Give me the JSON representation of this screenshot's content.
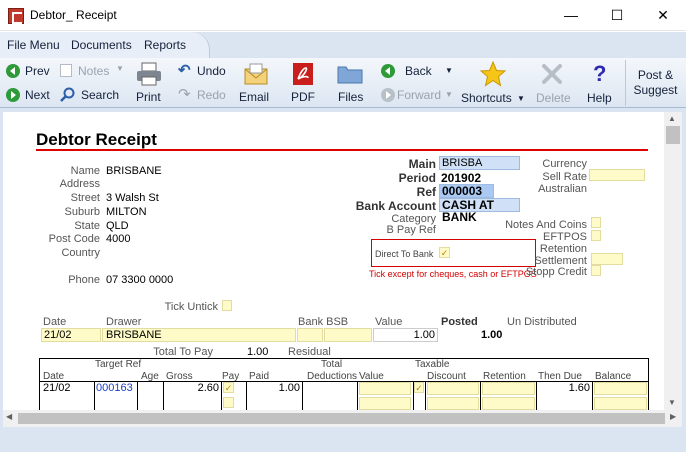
{
  "window": {
    "title": "Debtor_ Receipt",
    "minimize": "—",
    "maximize": "☐",
    "close": "✕"
  },
  "menu": {
    "items": [
      "File Menu",
      "Documents",
      "Reports"
    ]
  },
  "toolbar": {
    "prev": "Prev",
    "next": "Next",
    "notes": "Notes",
    "search": "Search",
    "print": "Print",
    "undo": "Undo",
    "redo": "Redo",
    "email": "Email",
    "pdf": "PDF",
    "files": "Files",
    "back": "Back",
    "forward": "Forward",
    "shortcuts": "Shortcuts",
    "delete": "Delete",
    "help": "Help",
    "post_suggest_1": "Post &",
    "post_suggest_2": "Suggest"
  },
  "form": {
    "heading": "Debtor Receipt",
    "name_label": "Name",
    "name": "BRISBANE",
    "address_label": "Address",
    "street_label": "Street",
    "street": "3 Walsh St",
    "suburb_label": "Suburb",
    "suburb": "MILTON",
    "state_label": "State",
    "state": "QLD",
    "postcode_label": "Post Code",
    "postcode": "4000",
    "country_label": "Country",
    "phone_label": "Phone",
    "phone": "07 3300 0000",
    "main_label": "Main",
    "main": "BRISBA",
    "period_label": "Period",
    "period": "201902",
    "ref_label": "Ref",
    "ref": "000003",
    "bank_account_label": "Bank Account",
    "bank_account": "CASH AT BANK",
    "category_label": "Category",
    "bpay_label": "B Pay Ref",
    "currency_label": "Currency",
    "sell_rate_label": "Sell Rate",
    "australian_label": "Australian",
    "notes_coins_label": "Notes And Coins",
    "eftpos_label": "EFTPOS",
    "retention_label": "Retention",
    "settlement_label": "Settlement",
    "stopp_credit_label": "Stopp Credit",
    "direct_bank_label": "Direct To Bank",
    "direct_bank_check": "✓",
    "tick_note": "Tick except for cheques, cash or EFTPOS",
    "tick_untick": "Tick Untick"
  },
  "receipt_row": {
    "date_label": "Date",
    "drawer_label": "Drawer",
    "bank_bsb_label": "Bank BSB",
    "value_label": "Value",
    "posted_label": "Posted",
    "undistributed_label": "Un Distributed",
    "date": "21/02",
    "drawer": "BRISBANE",
    "value": "1.00",
    "posted": "1.00",
    "total_to_pay_label": "Total To Pay",
    "total_to_pay": "1.00",
    "residual_label": "Residual"
  },
  "alloc_table": {
    "headers_top": {
      "target_ref": "Target Ref",
      "total": "Total",
      "taxable": "Taxable"
    },
    "headers": {
      "date": "Date",
      "age": "Age",
      "gross": "Gross",
      "pay": "Pay",
      "paid": "Paid",
      "deductions": "Deductions",
      "value": "Value",
      "discount": "Discount",
      "retention": "Retention",
      "then_due": "Then Due",
      "balance": "Balance"
    },
    "rows": [
      {
        "date": "21/02",
        "ref": "000163",
        "gross": "2.60",
        "pay": "✓",
        "paid": "1.00",
        "taxable": "✓",
        "then_due": "1.60"
      }
    ]
  }
}
